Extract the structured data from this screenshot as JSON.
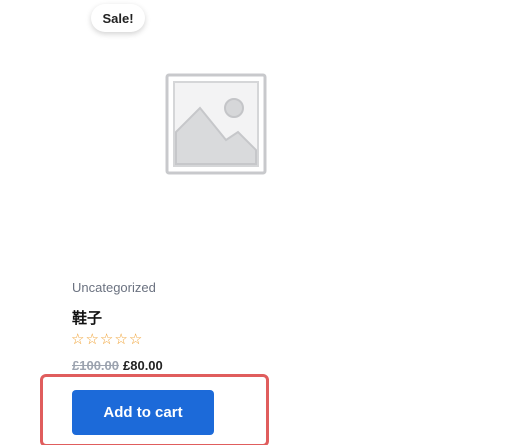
{
  "product": {
    "badge": "Sale!",
    "image_icon": "image-placeholder-icon",
    "category": "Uncategorized",
    "title": "鞋子",
    "rating": {
      "value": 0,
      "max": 5,
      "star_icon": "star-outline-icon"
    },
    "price": {
      "regular": "£100.00",
      "sale": "£80.00"
    },
    "add_to_cart_label": "Add to cart"
  },
  "colors": {
    "button": "#1c6ad9",
    "highlight": "#e05d5d",
    "star": "#f0a030"
  }
}
